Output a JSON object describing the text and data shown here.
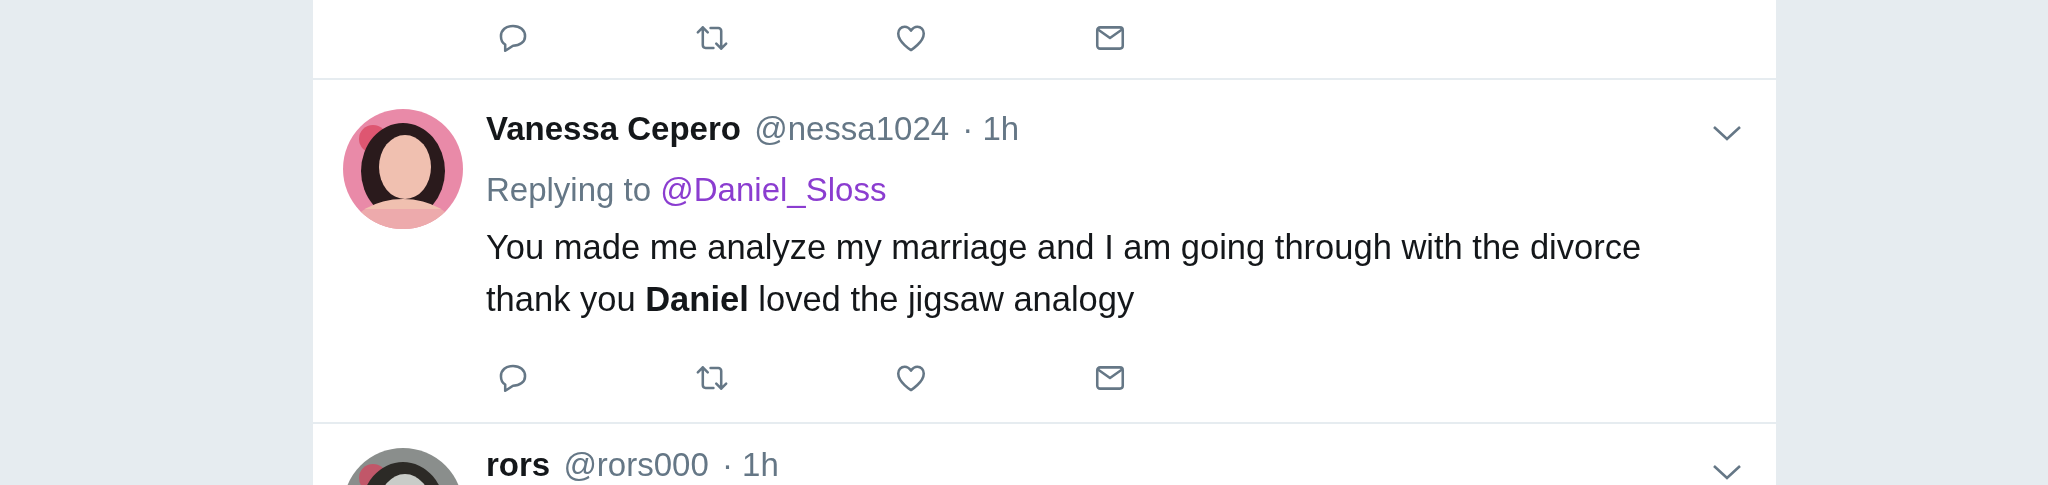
{
  "tweets": [
    {
      "kind": "actions"
    },
    {
      "kind": "full",
      "name": "Vanessa Cepero",
      "handle": "@nessa1024",
      "time": "· 1h",
      "replying_prefix": "Replying to",
      "replying_handle": "@Daniel_Sloss",
      "lines": [
        "You made me analyze my marriage and I am going through with the divorce",
        "thank you **Daniel** loved the jigsaw analogy"
      ]
    },
    {
      "kind": "header",
      "name": "rors",
      "handle": "@rors000",
      "time": "· 1h"
    }
  ]
}
